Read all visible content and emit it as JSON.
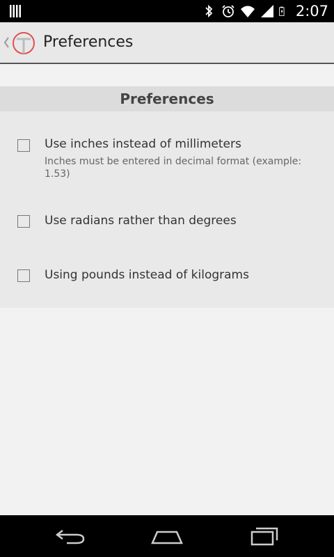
{
  "status_bar": {
    "time": "2:07",
    "icons": [
      "notification-bars-icon",
      "bluetooth-icon",
      "alarm-icon",
      "wifi-icon",
      "signal-icon",
      "battery-icon"
    ]
  },
  "action_bar": {
    "title": "Preferences",
    "logo_color": "#e05050"
  },
  "preferences": {
    "header": "Preferences",
    "items": [
      {
        "title": "Use inches instead of millimeters",
        "summary": "Inches must be entered in decimal format (example: 1.53)",
        "checked": false
      },
      {
        "title": "Use radians rather than degrees",
        "summary": "",
        "checked": false
      },
      {
        "title": "Using pounds instead of kilograms",
        "summary": "",
        "checked": false
      }
    ]
  },
  "nav_bar": {
    "buttons": [
      "back-icon",
      "home-icon",
      "recent-apps-icon"
    ]
  }
}
